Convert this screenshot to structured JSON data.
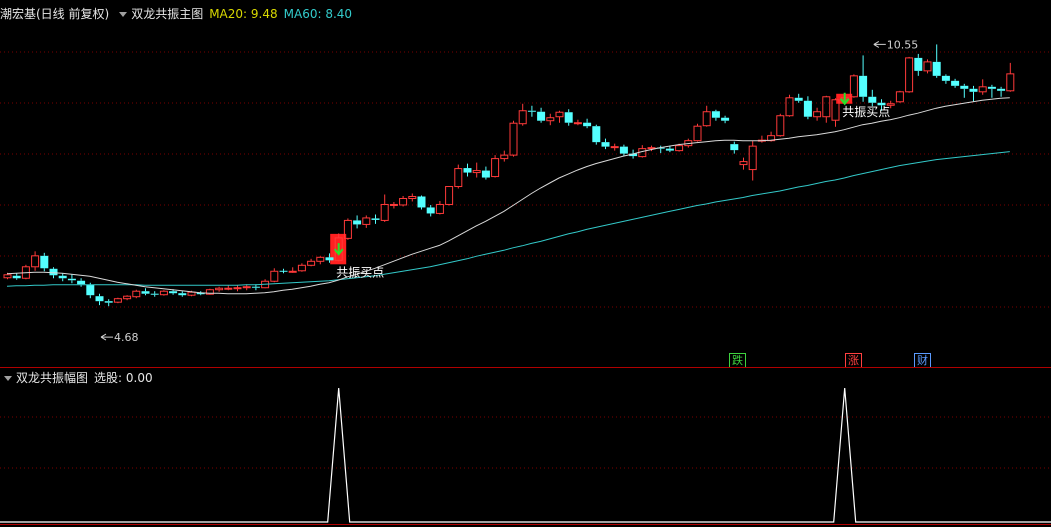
{
  "main_header": {
    "stock_title": "潮宏基(日线 前复权)",
    "indicator_name": "双龙共振主图",
    "ma20_label": "MA20: 9.48",
    "ma60_label": "MA60: 8.40"
  },
  "sub_header": {
    "indicator_name": "双龙共振幅图",
    "value_label": "选股: 0.00"
  },
  "badges": [
    {
      "text": "跌",
      "color": "#3fd23f"
    },
    {
      "text": "涨",
      "color": "#ff4040"
    },
    {
      "text": "财",
      "color": "#5b9bff"
    }
  ],
  "colors": {
    "up": "#ff3a3a",
    "down": "#54ffff",
    "ma20": "#d9d9d9",
    "ma60": "#33c9c9",
    "grid": "#7a0000",
    "separator": "#b00000",
    "signal_box": "#ff2020",
    "signal_arrow": "#28e028",
    "pulse": "#ffffff"
  },
  "chart_data": [
    {
      "type": "candlestick",
      "title": "双龙共振主图",
      "ylim": [
        4.1,
        11.0
      ],
      "annotations": [
        {
          "text": "10.55",
          "at_index": 94,
          "value": 10.55
        },
        {
          "text": "4.68",
          "at_index": 10,
          "value": 4.68
        },
        {
          "text": "共振买点",
          "at_index": 36,
          "value": 5.9
        },
        {
          "text": "共振买点",
          "at_index": 91,
          "value": 9.32
        }
      ],
      "signal_indices": [
        36,
        91
      ],
      "series": [
        {
          "name": "K",
          "ohlc": [
            [
              5.87,
              5.97,
              5.84,
              5.93
            ],
            [
              5.91,
              5.96,
              5.83,
              5.86
            ],
            [
              5.86,
              6.13,
              5.84,
              6.09
            ],
            [
              6.09,
              6.4,
              6.01,
              6.31
            ],
            [
              6.31,
              6.37,
              6.0,
              6.06
            ],
            [
              6.05,
              6.08,
              5.86,
              5.92
            ],
            [
              5.91,
              5.96,
              5.8,
              5.86
            ],
            [
              5.85,
              5.94,
              5.76,
              5.82
            ],
            [
              5.81,
              5.86,
              5.69,
              5.74
            ],
            [
              5.73,
              5.77,
              5.46,
              5.52
            ],
            [
              5.5,
              5.55,
              5.32,
              5.4
            ],
            [
              5.4,
              5.44,
              5.3,
              5.37
            ],
            [
              5.38,
              5.47,
              5.36,
              5.45
            ],
            [
              5.45,
              5.52,
              5.42,
              5.5
            ],
            [
              5.49,
              5.63,
              5.46,
              5.6
            ],
            [
              5.6,
              5.66,
              5.52,
              5.55
            ],
            [
              5.55,
              5.6,
              5.49,
              5.53
            ],
            [
              5.53,
              5.62,
              5.51,
              5.6
            ],
            [
              5.6,
              5.64,
              5.53,
              5.56
            ],
            [
              5.56,
              5.6,
              5.49,
              5.52
            ],
            [
              5.52,
              5.61,
              5.5,
              5.58
            ],
            [
              5.57,
              5.6,
              5.52,
              5.54
            ],
            [
              5.54,
              5.65,
              5.53,
              5.63
            ],
            [
              5.63,
              5.69,
              5.59,
              5.66
            ],
            [
              5.66,
              5.72,
              5.62,
              5.66
            ],
            [
              5.66,
              5.72,
              5.6,
              5.67
            ],
            [
              5.67,
              5.74,
              5.62,
              5.69
            ],
            [
              5.69,
              5.74,
              5.62,
              5.67
            ],
            [
              5.67,
              5.84,
              5.66,
              5.8
            ],
            [
              5.8,
              6.06,
              5.78,
              6.0
            ],
            [
              6.01,
              6.05,
              5.96,
              6.0
            ],
            [
              6.0,
              6.08,
              5.97,
              6.0
            ],
            [
              6.01,
              6.16,
              5.99,
              6.12
            ],
            [
              6.12,
              6.25,
              6.1,
              6.2
            ],
            [
              6.2,
              6.3,
              6.14,
              6.28
            ],
            [
              6.28,
              6.36,
              6.17,
              6.22
            ],
            [
              6.22,
              6.76,
              6.2,
              6.67
            ],
            [
              6.66,
              7.06,
              6.63,
              7.02
            ],
            [
              7.02,
              7.12,
              6.86,
              6.94
            ],
            [
              6.94,
              7.12,
              6.87,
              7.07
            ],
            [
              7.06,
              7.14,
              6.95,
              7.03
            ],
            [
              7.02,
              7.54,
              6.99,
              7.34
            ],
            [
              7.33,
              7.39,
              7.26,
              7.34
            ],
            [
              7.33,
              7.51,
              7.3,
              7.46
            ],
            [
              7.46,
              7.56,
              7.4,
              7.5
            ],
            [
              7.5,
              7.52,
              7.24,
              7.28
            ],
            [
              7.28,
              7.33,
              7.1,
              7.16
            ],
            [
              7.16,
              7.41,
              7.14,
              7.34
            ],
            [
              7.34,
              7.71,
              7.32,
              7.7
            ],
            [
              7.7,
              8.14,
              7.66,
              8.06
            ],
            [
              8.07,
              8.16,
              7.9,
              7.98
            ],
            [
              7.98,
              8.18,
              7.88,
              8.02
            ],
            [
              8.02,
              8.1,
              7.84,
              7.88
            ],
            [
              7.9,
              8.33,
              7.88,
              8.26
            ],
            [
              8.26,
              8.42,
              8.2,
              8.33
            ],
            [
              8.33,
              9.02,
              8.3,
              8.97
            ],
            [
              8.96,
              9.36,
              8.92,
              9.22
            ],
            [
              9.22,
              9.32,
              9.1,
              9.2
            ],
            [
              9.2,
              9.28,
              8.98,
              9.02
            ],
            [
              9.02,
              9.16,
              8.93,
              9.08
            ],
            [
              9.1,
              9.22,
              8.98,
              9.19
            ],
            [
              9.19,
              9.25,
              8.92,
              8.98
            ],
            [
              8.98,
              9.04,
              8.93,
              8.98
            ],
            [
              8.98,
              9.06,
              8.87,
              8.91
            ],
            [
              8.91,
              8.94,
              8.54,
              8.59
            ],
            [
              8.59,
              8.66,
              8.45,
              8.5
            ],
            [
              8.5,
              8.56,
              8.42,
              8.5
            ],
            [
              8.5,
              8.54,
              8.31,
              8.36
            ],
            [
              8.36,
              8.44,
              8.26,
              8.31
            ],
            [
              8.3,
              8.53,
              8.28,
              8.46
            ],
            [
              8.46,
              8.52,
              8.41,
              8.48
            ],
            [
              8.48,
              8.52,
              8.37,
              8.46
            ],
            [
              8.46,
              8.52,
              8.39,
              8.42
            ],
            [
              8.42,
              8.56,
              8.4,
              8.52
            ],
            [
              8.52,
              8.66,
              8.48,
              8.62
            ],
            [
              8.62,
              8.96,
              8.6,
              8.91
            ],
            [
              8.92,
              9.32,
              8.9,
              9.2
            ],
            [
              9.21,
              9.24,
              9.02,
              9.08
            ],
            [
              9.08,
              9.12,
              8.97,
              9.02
            ],
            [
              8.55,
              8.6,
              8.36,
              8.43
            ],
            [
              8.14,
              8.28,
              8.04,
              8.2
            ],
            [
              8.04,
              8.62,
              7.82,
              8.51
            ],
            [
              8.63,
              8.72,
              8.58,
              8.63
            ],
            [
              8.62,
              8.8,
              8.6,
              8.72
            ],
            [
              8.72,
              9.16,
              8.7,
              9.12
            ],
            [
              9.12,
              9.54,
              9.1,
              9.48
            ],
            [
              9.48,
              9.56,
              9.38,
              9.42
            ],
            [
              9.42,
              9.51,
              9.05,
              9.1
            ],
            [
              9.1,
              9.28,
              9.02,
              9.2
            ],
            [
              9.1,
              9.52,
              8.98,
              9.5
            ],
            [
              9.03,
              9.47,
              8.9,
              9.44
            ],
            [
              9.44,
              9.51,
              9.38,
              9.48
            ],
            [
              9.5,
              9.95,
              9.48,
              9.92
            ],
            [
              9.92,
              10.33,
              9.4,
              9.5
            ],
            [
              9.5,
              9.64,
              9.31,
              9.38
            ],
            [
              9.38,
              9.45,
              9.22,
              9.33
            ],
            [
              9.33,
              9.42,
              9.27,
              9.36
            ],
            [
              9.4,
              9.62,
              9.38,
              9.6
            ],
            [
              9.6,
              10.3,
              9.58,
              10.28
            ],
            [
              10.28,
              10.36,
              9.92,
              10.02
            ],
            [
              10.02,
              10.25,
              9.97,
              10.2
            ],
            [
              10.2,
              10.55,
              9.88,
              9.92
            ],
            [
              9.92,
              9.95,
              9.76,
              9.82
            ],
            [
              9.82,
              9.86,
              9.68,
              9.72
            ],
            [
              9.72,
              9.76,
              9.48,
              9.66
            ],
            [
              9.66,
              9.72,
              9.4,
              9.6
            ],
            [
              9.6,
              9.85,
              9.54,
              9.7
            ],
            [
              9.7,
              9.74,
              9.48,
              9.66
            ],
            [
              9.66,
              9.7,
              9.5,
              9.62
            ],
            [
              9.62,
              10.18,
              9.6,
              9.96
            ]
          ]
        },
        {
          "name": "MA20",
          "values": [
            5.95,
            5.96,
            5.97,
            5.98,
            5.98,
            5.97,
            5.96,
            5.94,
            5.92,
            5.9,
            5.86,
            5.82,
            5.78,
            5.75,
            5.72,
            5.69,
            5.67,
            5.65,
            5.63,
            5.61,
            5.59,
            5.57,
            5.56,
            5.56,
            5.55,
            5.55,
            5.55,
            5.56,
            5.57,
            5.59,
            5.62,
            5.64,
            5.67,
            5.7,
            5.74,
            5.77,
            5.82,
            5.89,
            5.94,
            6.0,
            6.06,
            6.13,
            6.2,
            6.27,
            6.34,
            6.4,
            6.46,
            6.52,
            6.61,
            6.71,
            6.81,
            6.91,
            7.0,
            7.1,
            7.2,
            7.32,
            7.44,
            7.56,
            7.67,
            7.77,
            7.87,
            7.95,
            8.03,
            8.1,
            8.16,
            8.21,
            8.26,
            8.31,
            8.35,
            8.4,
            8.44,
            8.48,
            8.51,
            8.54,
            8.56,
            8.58,
            8.6,
            8.62,
            8.63,
            8.63,
            8.62,
            8.62,
            8.62,
            8.63,
            8.65,
            8.67,
            8.7,
            8.72,
            8.74,
            8.77,
            8.8,
            8.84,
            8.89,
            8.94,
            8.97,
            9.01,
            9.04,
            9.08,
            9.13,
            9.17,
            9.22,
            9.27,
            9.31,
            9.34,
            9.37,
            9.4,
            9.43,
            9.45,
            9.47,
            9.48
          ]
        },
        {
          "name": "MA60",
          "values": [
            5.7,
            5.71,
            5.71,
            5.72,
            5.72,
            5.73,
            5.73,
            5.73,
            5.73,
            5.73,
            5.73,
            5.73,
            5.73,
            5.73,
            5.73,
            5.72,
            5.72,
            5.72,
            5.72,
            5.72,
            5.72,
            5.72,
            5.72,
            5.72,
            5.72,
            5.72,
            5.73,
            5.73,
            5.74,
            5.75,
            5.76,
            5.77,
            5.78,
            5.79,
            5.8,
            5.81,
            5.83,
            5.85,
            5.87,
            5.89,
            5.91,
            5.94,
            5.97,
            6.0,
            6.03,
            6.06,
            6.09,
            6.13,
            6.17,
            6.21,
            6.25,
            6.3,
            6.34,
            6.38,
            6.42,
            6.47,
            6.51,
            6.56,
            6.6,
            6.65,
            6.7,
            6.75,
            6.79,
            6.84,
            6.88,
            6.92,
            6.96,
            7.0,
            7.04,
            7.08,
            7.12,
            7.16,
            7.2,
            7.24,
            7.28,
            7.32,
            7.35,
            7.39,
            7.42,
            7.45,
            7.48,
            7.52,
            7.55,
            7.58,
            7.61,
            7.65,
            7.69,
            7.72,
            7.76,
            7.8,
            7.83,
            7.87,
            7.92,
            7.96,
            8.0,
            8.04,
            8.08,
            8.12,
            8.15,
            8.18,
            8.21,
            8.24,
            8.26,
            8.28,
            8.3,
            8.32,
            8.34,
            8.36,
            8.38,
            8.4
          ]
        }
      ]
    },
    {
      "type": "line",
      "title": "双龙共振幅图",
      "ylim": [
        0,
        1
      ],
      "series": [
        {
          "name": "选股",
          "pulse_indices": [
            36,
            91
          ],
          "value": 1
        }
      ]
    }
  ]
}
